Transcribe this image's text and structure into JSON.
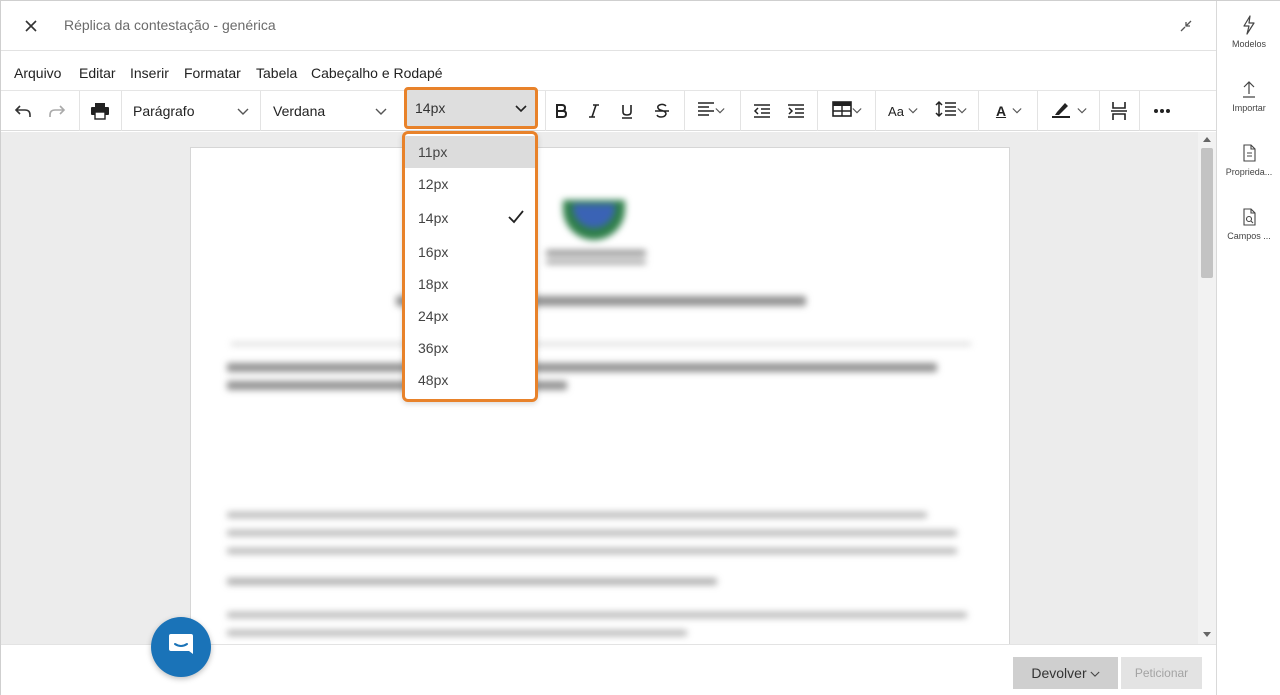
{
  "window": {
    "title": "Réplica da contestação - genérica"
  },
  "sidebar": {
    "items": [
      {
        "label": "Modelos",
        "icon": "lightning-icon"
      },
      {
        "label": "Importar",
        "icon": "upload-icon"
      },
      {
        "label": "Proprieda...",
        "icon": "document-properties-icon"
      },
      {
        "label": "Campos ...",
        "icon": "document-search-icon"
      }
    ]
  },
  "menu": {
    "items": [
      "Arquivo",
      "Editar",
      "Inserir",
      "Formatar",
      "Tabela",
      "Cabeçalho e Rodapé"
    ]
  },
  "toolbar": {
    "block_format": "Parágrafo",
    "font_family": "Verdana",
    "font_size": "14px",
    "font_case_label": "Aa",
    "text_color_label": "A"
  },
  "font_size_dropdown": {
    "options": [
      "11px",
      "12px",
      "14px",
      "16px",
      "18px",
      "24px",
      "36px",
      "48px"
    ],
    "selected": "14px",
    "hovered": "11px"
  },
  "footer": {
    "return_label": "Devolver",
    "petition_label": "Peticionar"
  },
  "colors": {
    "highlight_orange": "#e8822a",
    "chat_blue": "#1a73b8",
    "editor_bg": "#ececec"
  }
}
